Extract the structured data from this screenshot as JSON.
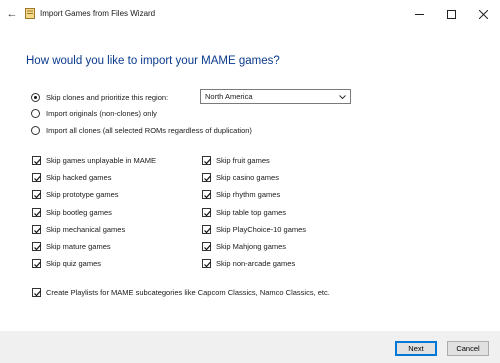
{
  "window": {
    "title": "Import Games from Files Wizard"
  },
  "heading": "How would you like to import your MAME games?",
  "import_options": [
    {
      "label": "Skip clones and prioritize this region:",
      "selected": true
    },
    {
      "label": "Import originals (non-clones) only",
      "selected": false
    },
    {
      "label": "Import all clones (all selected ROMs regardless of duplication)",
      "selected": false
    }
  ],
  "region_select": {
    "value": "North America"
  },
  "skip_left": [
    {
      "label": "Skip games unplayable in MAME",
      "checked": true
    },
    {
      "label": "Skip hacked games",
      "checked": true
    },
    {
      "label": "Skip prototype games",
      "checked": true
    },
    {
      "label": "Skip bootleg games",
      "checked": true
    },
    {
      "label": "Skip mechanical games",
      "checked": true
    },
    {
      "label": "Skip mature games",
      "checked": true
    },
    {
      "label": "Skip quiz games",
      "checked": true
    }
  ],
  "skip_right": [
    {
      "label": "Skip fruit games",
      "checked": true
    },
    {
      "label": "Skip casino games",
      "checked": true
    },
    {
      "label": "Skip rhythm games",
      "checked": true
    },
    {
      "label": "Skip table top games",
      "checked": true
    },
    {
      "label": "Skip PlayChoice-10 games",
      "checked": true
    },
    {
      "label": "Skip Mahjong games",
      "checked": true
    },
    {
      "label": "Skip non-arcade games",
      "checked": true
    }
  ],
  "playlists_option": {
    "label": "Create Playlists for MAME subcategories like Capcom Classics, Namco Classics, etc.",
    "checked": true
  },
  "buttons": {
    "next": "Next",
    "cancel": "Cancel"
  },
  "colors": {
    "heading": "#0a3a8c",
    "primary_border": "#0078d7"
  }
}
